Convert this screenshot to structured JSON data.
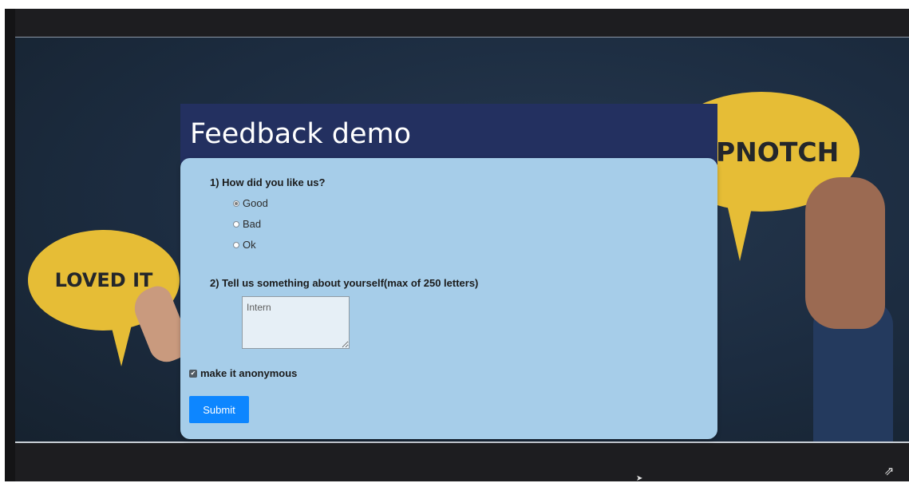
{
  "form": {
    "title": "Feedback demo",
    "q1_label": "1) How did you like us?",
    "options": [
      {
        "label": "Good",
        "checked": true
      },
      {
        "label": "Bad",
        "checked": false
      },
      {
        "label": "Ok",
        "checked": false
      }
    ],
    "q2_label": "2) Tell us something about yourself(max of 250 letters)",
    "about_value": "Intern",
    "anonymous_label": "make it anonymous",
    "anonymous_checked": true,
    "submit_label": "Submit"
  },
  "background": {
    "bubble_left_text": "LOVED IT",
    "bubble_right_text": "PNOTCH"
  },
  "player": {
    "exit_fullscreen_icon": "exit-fullscreen-icon",
    "cursor_icon": "cursor-icon"
  },
  "colors": {
    "header_bg": "#233060",
    "panel_bg": "#a6cde9",
    "submit_bg": "#0d86ff",
    "bubble": "#e6bd36"
  }
}
